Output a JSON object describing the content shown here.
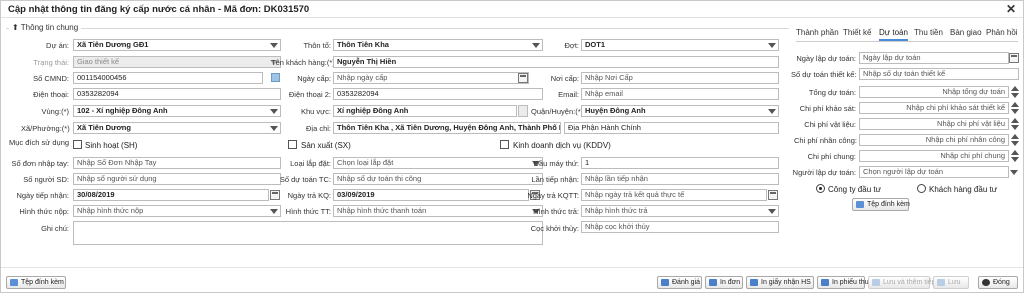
{
  "window": {
    "title": "Cập nhật thông tin đăng ký cấp nước cá nhân - Mã đơn: DK031570",
    "close_icon": "close-icon"
  },
  "general_info_legend": "Thông tin chung",
  "fields": {
    "du_an": {
      "label": "Dự án:",
      "value": "Xã Tiên Dương GĐ1"
    },
    "thon_to": {
      "label": "Thôn tổ:",
      "value": "Thôn Tiên Kha"
    },
    "dot": {
      "label": "Đợt:",
      "value": "DOT1"
    },
    "trang_thai": {
      "label": "Trạng thái:",
      "value": "Giao thiết kế"
    },
    "ten_khach_hang": {
      "label": "Tên khách hàng:(*)",
      "value": "Nguyễn Thị Hiền"
    },
    "so_cmnd": {
      "label": "Số CMND:",
      "value": "001154000456"
    },
    "ngay_cap": {
      "label": "Ngày cấp:",
      "placeholder": "Nhập ngày cấp"
    },
    "noi_cap": {
      "label": "Nơi cấp:",
      "placeholder": "Nhập Nơi Cấp"
    },
    "dien_thoai": {
      "label": "Điện thoại:",
      "value": "0353282094"
    },
    "dien_thoai_2": {
      "label": "Điện thoại 2:",
      "value": "0353282094"
    },
    "email": {
      "label": "Email:",
      "placeholder": "Nhập email"
    },
    "vung": {
      "label": "Vùng:(*)",
      "value": "102 - Xí nghiệp Đông Anh"
    },
    "khu_vuc": {
      "label": "Khu vực:",
      "value": "Xí nghiệp Đông Anh"
    },
    "quan_huyen": {
      "label": "Quận/Huyện:(*)",
      "value": "Huyện Đông Anh"
    },
    "xa_phuong": {
      "label": "Xã/Phường:(*)",
      "value": "Xã Tiên Dương"
    },
    "dia_chi": {
      "label": "Địa chỉ:",
      "value": "Thôn Tiên Kha , Xã Tiên Dương, Huyện Đông Anh, Thành Phố Hà Nội"
    },
    "dia_phan": {
      "value": "Địa Phận Hành Chính"
    },
    "muc_dich": {
      "label": "Mục đích sử dụng"
    },
    "so_don_nhap_tay": {
      "label": "Số đơn nhập tay:",
      "placeholder": "Nhập Số Đơn Nhập Tay"
    },
    "loai_lap_dat": {
      "label": "Loại lắp đặt:",
      "placeholder": "Chọn loại lắp đặt"
    },
    "dau_may_thu": {
      "label": "Đầu máy thứ:",
      "value": "1"
    },
    "so_nguoi_sd": {
      "label": "Số người SD:",
      "placeholder": "Nhập số người sử dụng"
    },
    "so_du_toan_tc": {
      "label": "Số dự toán TC:",
      "placeholder": "Nhập số dự toán thi công"
    },
    "lan_tiep_nhan": {
      "label": "Lần tiếp nhận:",
      "placeholder": "Nhập lần tiếp nhận"
    },
    "ngay_tiep_nhan": {
      "label": "Ngày tiếp nhận:",
      "value": "30/08/2019"
    },
    "ngay_tra_kq": {
      "label": "Ngày trả KQ:",
      "value": "03/09/2019"
    },
    "ngay_tra_kqtt": {
      "label": "Ngày trả KQTT:",
      "placeholder": "Nhập ngày trả kết quả thực tế"
    },
    "hinh_thuc_nop": {
      "label": "Hình thức nộp:",
      "placeholder": "Nhập hình thức nộp"
    },
    "hinh_thuc_tt": {
      "label": "Hình thức TT:",
      "placeholder": "Nhập hình thức thanh toán"
    },
    "hinh_thuc_tra": {
      "label": "Hình thức trả:",
      "placeholder": "Nhập hình thức trả"
    },
    "ghi_chu": {
      "label": "Ghi chú:"
    },
    "coc_khoi_thuy": {
      "label": "Cọc khởi thủy:",
      "placeholder": "Nhập cọc khởi thủy"
    }
  },
  "checkboxes": {
    "sinh_hoat": "Sinh hoạt (SH)",
    "san_xuat": "Sản xuất (SX)",
    "kinh_doanh": "Kinh doanh dịch vụ (KDDV)"
  },
  "tabs": [
    "Thành phần",
    "Thiết kế",
    "Dự toán",
    "Thu tiền",
    "Bàn giao",
    "Phản hồi"
  ],
  "active_tab": "Dự toán",
  "du_toan": {
    "ngay_lap": {
      "label": "Ngày lập dự toán:",
      "placeholder": "Ngày lập dự toán"
    },
    "so_du_toan_tk": {
      "label": "Số dự toán thiết kế:",
      "placeholder": "Nhập số dự toán thiết kế"
    },
    "tong_du_toan": {
      "label": "Tổng dự toán:",
      "placeholder": "Nhập tổng dự toán"
    },
    "chi_phi_khao_sat": {
      "label": "Chi phí khảo sát:",
      "placeholder": "Nhập chi phí khảo sát thiết kế"
    },
    "chi_phi_vat_lieu": {
      "label": "Chi phí vật liệu:",
      "placeholder": "Nhập chi phí vật liệu"
    },
    "chi_phi_nhan_cong": {
      "label": "Chi phí nhân công:",
      "placeholder": "Nhập chi phí nhân công"
    },
    "chi_phi_chung": {
      "label": "Chi phí chung:",
      "placeholder": "Nhập chi phí chung"
    },
    "nguoi_lap": {
      "label": "Người lập dự toán:",
      "placeholder": "Chọn người lập dự toán"
    },
    "radio_cong_ty": "Công ty đầu tư",
    "radio_khach_hang": "Khách hàng đầu tư",
    "attach_label": "Tệp đính kèm"
  },
  "footer": {
    "attach": "Tệp đính kèm",
    "danh_gia": "Đánh giá",
    "in_don": "In đơn",
    "in_giay_nhan_hs": "In giấy nhận HS",
    "in_phieu_thu": "In phiếu thu",
    "luu_va_them_tiep": "Lưu và thêm tiếp",
    "luu": "Lưu",
    "dong": "Đóng"
  }
}
